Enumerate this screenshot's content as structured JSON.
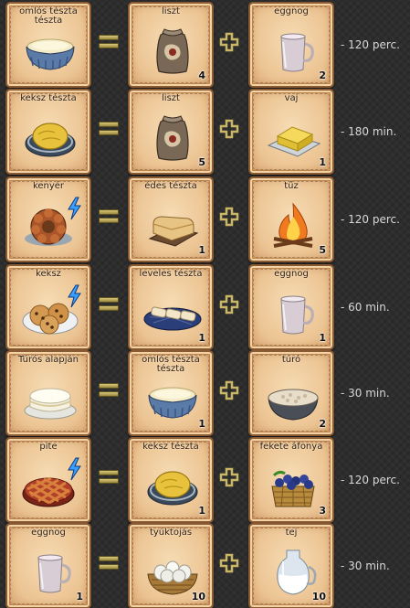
{
  "recipes": [
    {
      "output": {
        "name": "omlós tészta tészta",
        "icon": "bowl-dough-icon",
        "qty": ""
      },
      "ingredient1": {
        "name": "liszt",
        "icon": "flour-sack-icon",
        "qty": "4"
      },
      "ingredient2": {
        "name": "eggnog",
        "icon": "eggnog-mug-icon",
        "qty": "2"
      },
      "time": "- 120 perc."
    },
    {
      "output": {
        "name": "keksz tészta",
        "icon": "cookie-dough-icon",
        "qty": ""
      },
      "ingredient1": {
        "name": "liszt",
        "icon": "flour-sack-icon",
        "qty": "5"
      },
      "ingredient2": {
        "name": "vaj",
        "icon": "butter-icon",
        "qty": "1"
      },
      "time": "- 180 min."
    },
    {
      "output": {
        "name": "kenyér",
        "icon": "bread-ring-icon",
        "qty": ""
      },
      "ingredient1": {
        "name": "édes tészta",
        "icon": "sweet-dough-icon",
        "qty": "1"
      },
      "ingredient2": {
        "name": "tűz",
        "icon": "fire-icon",
        "qty": "5"
      },
      "time": "- 120 perc."
    },
    {
      "output": {
        "name": "keksz",
        "icon": "cookies-plate-icon",
        "qty": ""
      },
      "ingredient1": {
        "name": "leveles tészta",
        "icon": "puff-pastry-icon",
        "qty": "1"
      },
      "ingredient2": {
        "name": "eggnog",
        "icon": "eggnog-mug-icon",
        "qty": "1"
      },
      "time": "- 60 min."
    },
    {
      "output": {
        "name": "Túrós alapján",
        "icon": "cheesecake-icon",
        "qty": ""
      },
      "ingredient1": {
        "name": "omlós tészta tészta",
        "icon": "bowl-dough-icon",
        "qty": "1"
      },
      "ingredient2": {
        "name": "túró",
        "icon": "cottage-cheese-bowl-icon",
        "qty": "2"
      },
      "time": "- 30 min."
    },
    {
      "output": {
        "name": "pite",
        "icon": "lattice-pie-icon",
        "qty": ""
      },
      "ingredient1": {
        "name": "keksz tészta",
        "icon": "cookie-dough-icon",
        "qty": "1"
      },
      "ingredient2": {
        "name": "fekete áfonya",
        "icon": "blueberry-basket-icon",
        "qty": "3"
      },
      "time": "- 120 perc."
    },
    {
      "output": {
        "name": "eggnog",
        "icon": "eggnog-mug-icon",
        "qty": "1"
      },
      "ingredient1": {
        "name": "tyúktojás",
        "icon": "egg-basket-icon",
        "qty": "10"
      },
      "ingredient2": {
        "name": "tej",
        "icon": "milk-jug-icon",
        "qty": "10"
      },
      "time": "- 30 min."
    }
  ]
}
